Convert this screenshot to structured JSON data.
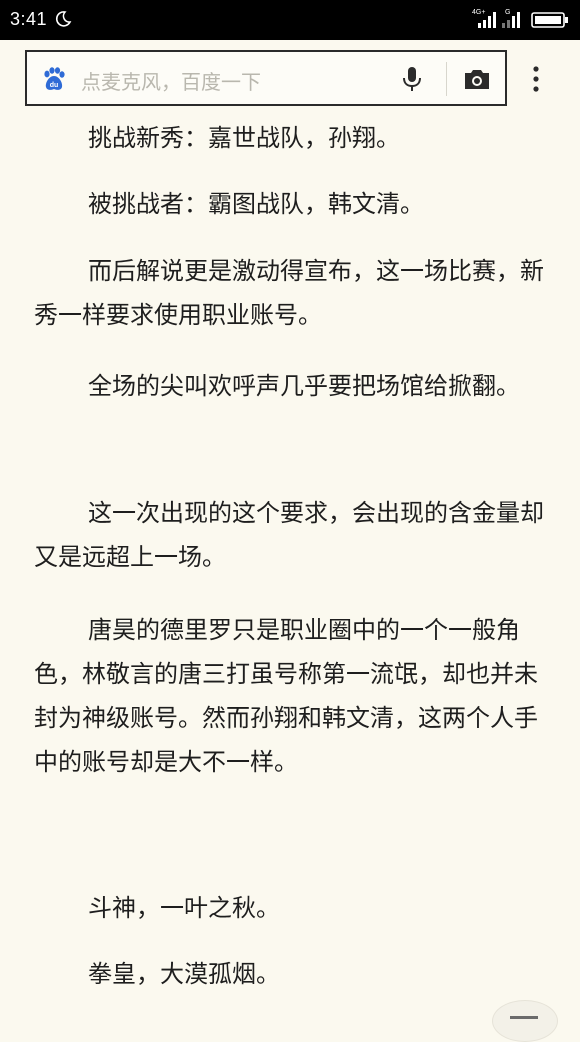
{
  "status_bar": {
    "time": "3:41",
    "network_label": "4G+",
    "sim2_label": "G",
    "icons": [
      "moon-icon",
      "signal-icon",
      "signal-icon-2",
      "battery-icon"
    ]
  },
  "search": {
    "placeholder": "点麦克风，百度一下",
    "icons": [
      "baidu-icon",
      "mic-icon",
      "camera-icon",
      "menu-icon"
    ]
  },
  "article": {
    "paragraphs": [
      "挑战新秀：嘉世战队，孙翔。",
      "被挑战者：霸图战队，韩文清。",
      "而后解说更是激动得宣布，这一场比赛，新秀一样要求使用职业账号。",
      "全场的尖叫欢呼声几乎要把场馆给掀翻。",
      "这一次出现的这个要求，会出现的含金量却又是远超上一场。",
      "唐昊的德里罗只是职业圈中的一个一般角色，林敬言的唐三打虽号称第一流氓，却也并未封为神级账号。然而孙翔和韩文清，这两个人手中的账号却是大不一样。",
      "斗神，一叶之秋。",
      "拳皇，大漠孤烟。"
    ]
  },
  "colors": {
    "background": "#fbf9ef",
    "text": "#1e1e1e",
    "placeholder": "#b9b7ae",
    "baidu_blue": "#2f6bd6"
  }
}
